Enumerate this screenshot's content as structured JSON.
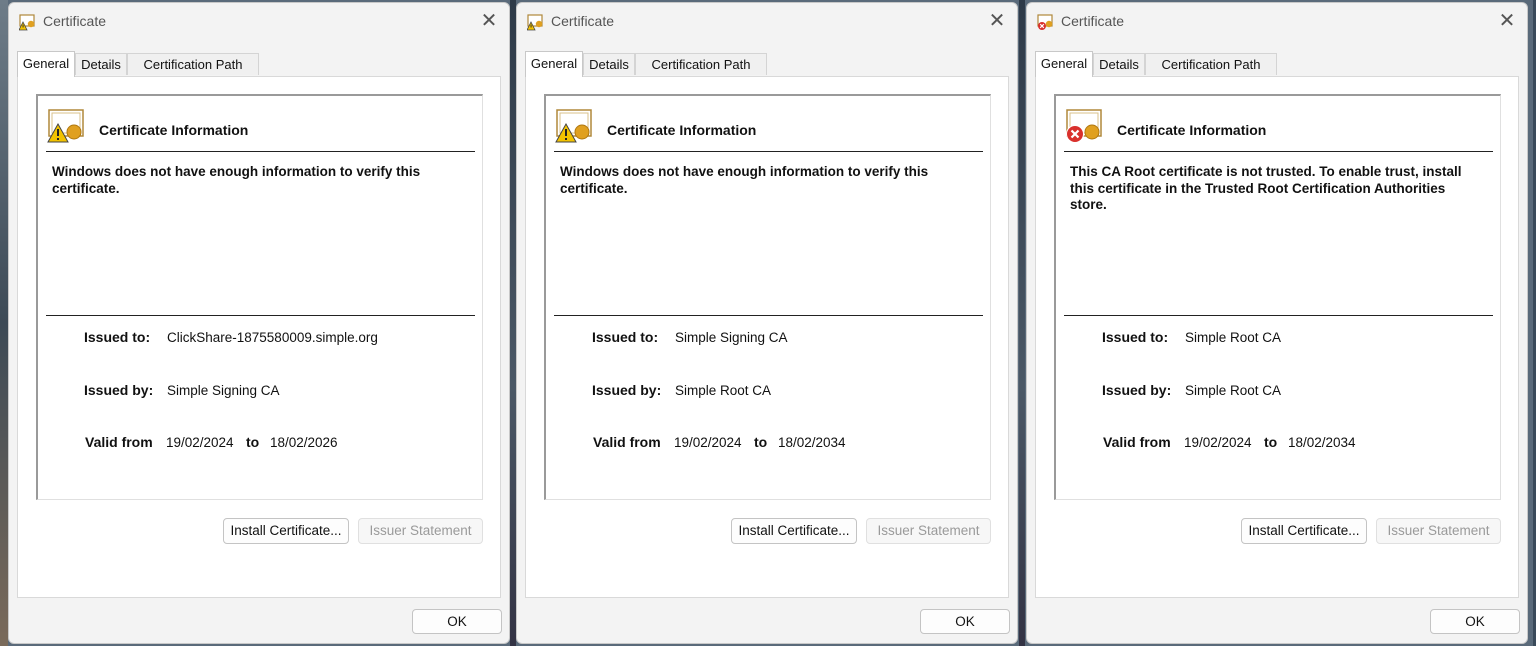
{
  "dialogs": [
    {
      "title": "Certificate",
      "icon": "warning",
      "tabs": [
        "General",
        "Details",
        "Certification Path"
      ],
      "info_title": "Certificate Information",
      "message": "Windows does not have enough information to verify this certificate.",
      "issued_to_label": "Issued to:",
      "issued_to": "ClickShare-1875580009.simple.org",
      "issued_by_label": "Issued by:",
      "issued_by": "Simple Signing CA",
      "valid_from_label": "Valid from",
      "valid_from": "19/02/2024",
      "to_label": "to",
      "valid_to": "18/02/2026",
      "install_button": "Install Certificate...",
      "issuer_button": "Issuer Statement",
      "ok_button": "OK"
    },
    {
      "title": "Certificate",
      "icon": "warning",
      "tabs": [
        "General",
        "Details",
        "Certification Path"
      ],
      "info_title": "Certificate Information",
      "message": "Windows does not have enough information to verify this certificate.",
      "issued_to_label": "Issued to:",
      "issued_to": "Simple Signing CA",
      "issued_by_label": "Issued by:",
      "issued_by": "Simple Root CA",
      "valid_from_label": "Valid from",
      "valid_from": "19/02/2024",
      "to_label": "to",
      "valid_to": "18/02/2034",
      "install_button": "Install Certificate...",
      "issuer_button": "Issuer Statement",
      "ok_button": "OK"
    },
    {
      "title": "Certificate",
      "icon": "error",
      "tabs": [
        "General",
        "Details",
        "Certification Path"
      ],
      "info_title": "Certificate Information",
      "message": "This CA Root certificate is not trusted. To enable trust, install this certificate in the Trusted Root Certification Authorities store.",
      "issued_to_label": "Issued to:",
      "issued_to": "Simple Root CA",
      "issued_by_label": "Issued by:",
      "issued_by": "Simple Root CA",
      "valid_from_label": "Valid from",
      "valid_from": "19/02/2024",
      "to_label": "to",
      "valid_to": "18/02/2034",
      "install_button": "Install Certificate...",
      "issuer_button": "Issuer Statement",
      "ok_button": "OK"
    }
  ],
  "colors": {
    "warning_badge": "#f2c200",
    "error_badge": "#d9302c",
    "seal": "#e0a020"
  }
}
